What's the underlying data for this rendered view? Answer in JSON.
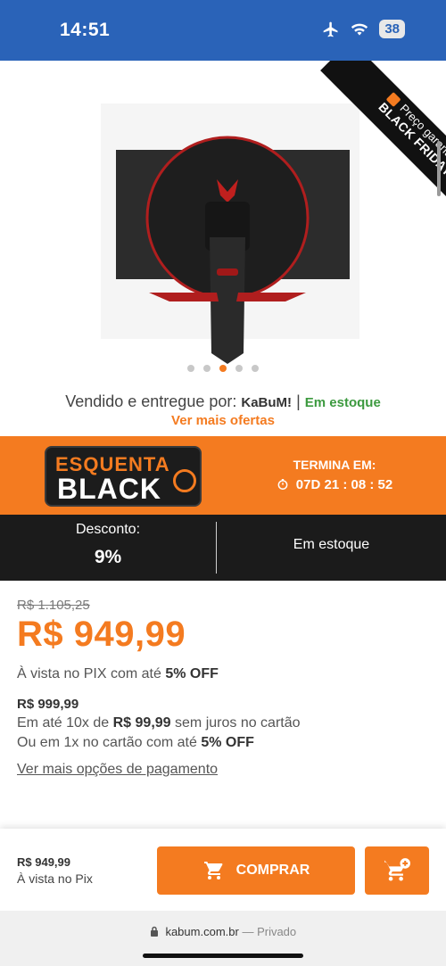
{
  "status": {
    "time": "14:51",
    "battery": "38"
  },
  "product": {
    "ribbon_line1": "Preço garantido",
    "ribbon_line2": "BLACK FRIDAY",
    "carousel": {
      "count": 5,
      "active": 3
    }
  },
  "seller": {
    "prefix": "Vendido e entregue por:",
    "name": "KaBuM!",
    "separator": "|",
    "stock": "Em estoque",
    "more_offers": "Ver mais ofertas"
  },
  "promo": {
    "logo_line1": "ESQUENTA",
    "logo_line2": "BLACK",
    "ends_label": "TERMINA EM:",
    "countdown": "07D 21 : 08 : 52"
  },
  "info": {
    "discount_label": "Desconto:",
    "discount_value": "9%",
    "stock": "Em estoque"
  },
  "prices": {
    "old": "R$ 1.105,25",
    "main": "R$ 949,99",
    "pix_text": "À vista no PIX com até",
    "pix_discount": "5% OFF",
    "card_total": "R$ 999,99",
    "inst_prefix": "Em até 10x de",
    "inst_value": "R$ 99,99",
    "inst_suffix": "sem juros no cartão",
    "onex_prefix": "Ou em 1x no cartão com até",
    "onex_discount": "5% OFF",
    "more_payment": "Ver mais opções de pagamento"
  },
  "bottom": {
    "price": "R$ 949,99",
    "sub": "À vista no Pix",
    "buy_label": "COMPRAR"
  },
  "browser": {
    "domain": "kabum.com.br",
    "private": "— Privado"
  },
  "colors": {
    "accent": "#f47b20",
    "status_bar": "#2a63b8",
    "stock_green": "#3c9a3f"
  }
}
